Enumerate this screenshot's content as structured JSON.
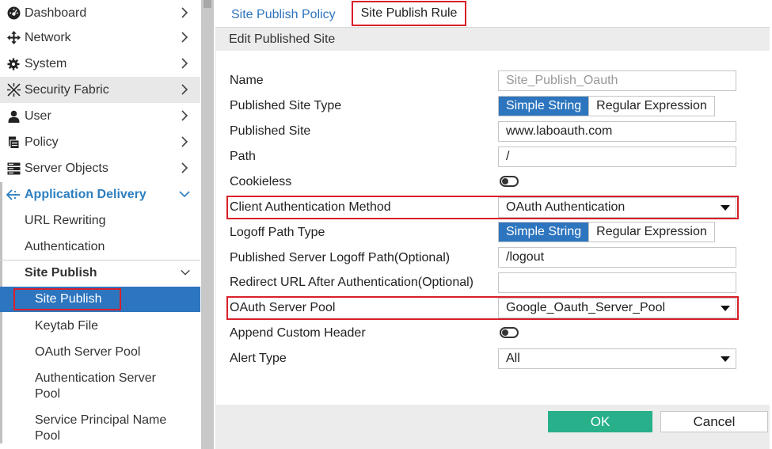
{
  "sidebar": {
    "items": [
      {
        "label": "Dashboard",
        "icon": "dashboard-icon"
      },
      {
        "label": "Network",
        "icon": "network-icon"
      },
      {
        "label": "System",
        "icon": "gear-icon"
      },
      {
        "label": "Security Fabric",
        "icon": "security-fabric-icon"
      },
      {
        "label": "User",
        "icon": "user-icon"
      },
      {
        "label": "Policy",
        "icon": "policy-icon"
      },
      {
        "label": "Server Objects",
        "icon": "server-icon"
      },
      {
        "label": "Application Delivery",
        "icon": "application-delivery-icon"
      }
    ],
    "sub_items": [
      {
        "label": "URL Rewriting"
      },
      {
        "label": "Authentication"
      },
      {
        "label": "Site Publish"
      }
    ],
    "site_publish_children": [
      {
        "label": "Site Publish"
      },
      {
        "label": "Keytab File"
      },
      {
        "label": "OAuth Server Pool"
      },
      {
        "label": "Authentication Server Pool"
      },
      {
        "label": "Service Principal Name Pool"
      }
    ]
  },
  "tabs": {
    "policy": "Site Publish Policy",
    "rule": "Site Publish Rule"
  },
  "section_title": "Edit Published Site",
  "form": {
    "name": {
      "label": "Name",
      "value": "Site_Publish_Oauth"
    },
    "site_type": {
      "label": "Published Site Type",
      "opt_on": "Simple String",
      "opt_off": "Regular Expression"
    },
    "site": {
      "label": "Published Site",
      "value": "www.laboauth.com"
    },
    "path": {
      "label": "Path",
      "value": "/"
    },
    "cookieless": {
      "label": "Cookieless"
    },
    "client_auth": {
      "label": "Client Authentication Method",
      "value": "OAuth Authentication"
    },
    "logoff_type": {
      "label": "Logoff Path Type",
      "opt_on": "Simple String",
      "opt_off": "Regular Expression"
    },
    "logoff_path": {
      "label": "Published Server Logoff Path(Optional)",
      "value": "/logout"
    },
    "redirect": {
      "label": "Redirect URL After Authentication(Optional)",
      "value": ""
    },
    "oauth_pool": {
      "label": "OAuth Server Pool",
      "value": "Google_Oauth_Server_Pool"
    },
    "custom_header": {
      "label": "Append Custom Header"
    },
    "alert_type": {
      "label": "Alert Type",
      "value": "All"
    }
  },
  "buttons": {
    "ok": "OK",
    "cancel": "Cancel"
  },
  "colors": {
    "accent": "#2d75be",
    "ok": "#27b08a",
    "highlight_border": "#d9202a"
  }
}
